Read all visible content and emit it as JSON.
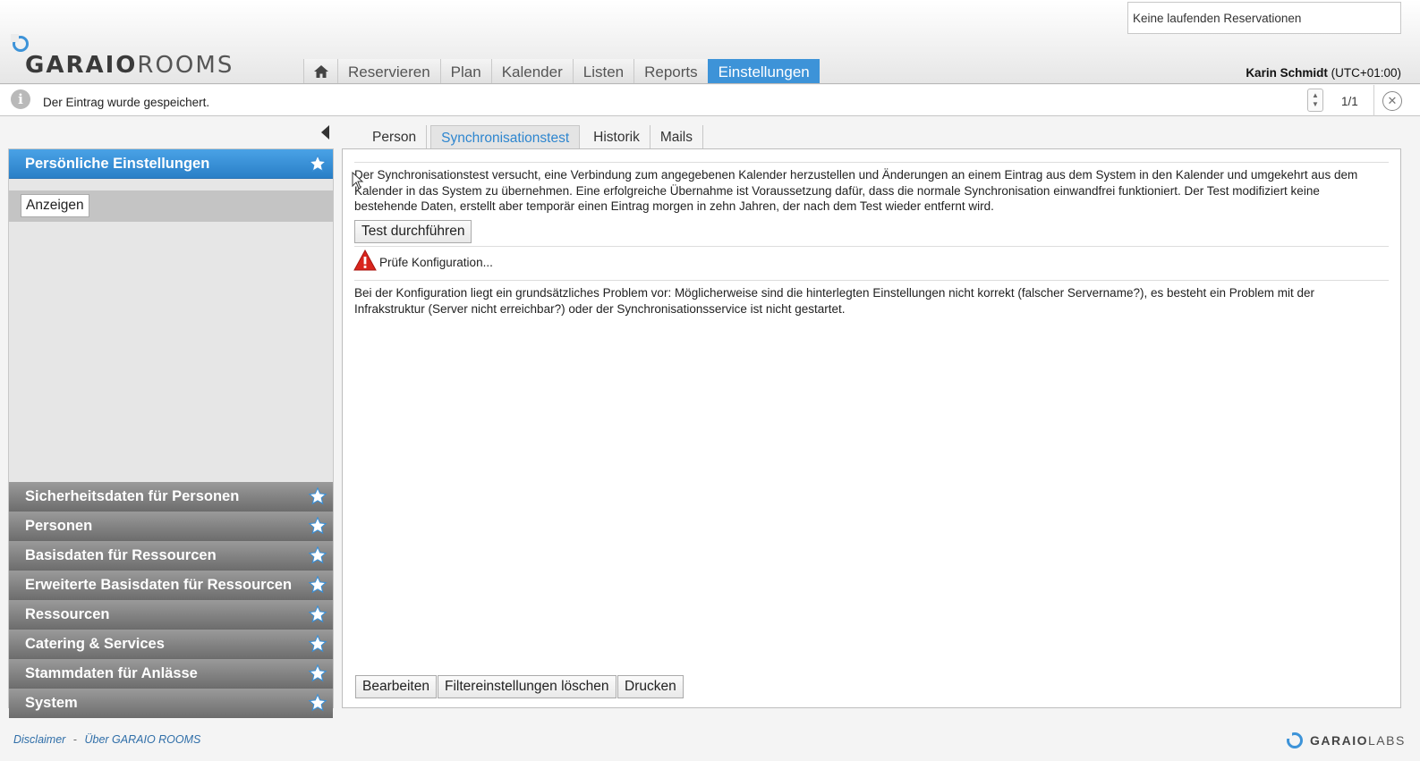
{
  "header": {
    "logo_bold": "GARAIO",
    "logo_light": "ROOMS",
    "reservations_status": "Keine laufenden Reservationen",
    "nav": [
      "Reservieren",
      "Plan",
      "Kalender",
      "Listen",
      "Reports",
      "Einstellungen"
    ],
    "active_nav": "Einstellungen",
    "user_name": "Karin Schmidt",
    "user_tz": "(UTC+01:00)"
  },
  "infobar": {
    "message": "Der Eintrag wurde gespeichert.",
    "pager": "1/1"
  },
  "sidebar": {
    "active_section": "Persönliche Einstellungen",
    "active_sub_button": "Anzeigen",
    "sections": [
      "Sicherheitsdaten für Personen",
      "Personen",
      "Basisdaten für Ressourcen",
      "Erweiterte Basisdaten für Ressourcen",
      "Ressourcen",
      "Catering & Services",
      "Stammdaten für Anlässe",
      "System"
    ]
  },
  "tabs": [
    "Person",
    "Synchronisationstest",
    "Historik",
    "Mails"
  ],
  "active_tab": "Synchronisationstest",
  "main": {
    "intro": "Der Synchronisationstest versucht, eine Verbindung zum angegebenen Kalender herzustellen und Änderungen an einem Eintrag aus dem System in den Kalender und umgekehrt aus dem Kalender in das System zu übernehmen. Eine erfolgreiche Übernahme ist Voraussetzung dafür, dass die normale Synchronisation einwandfrei funktioniert. Der Test modifiziert keine bestehende Daten, erstellt aber temporär einen Eintrag morgen in zehn Jahren, der nach dem Test wieder entfernt wird.",
    "run_test_label": "Test durchführen",
    "check_status": "Prüfe Konfiguration...",
    "error_text": "Bei der Konfiguration liegt ein grundsätzliches Problem vor: Möglicherweise sind die hinterlegten Einstellungen nicht korrekt (falscher Servername?), es besteht ein Problem mit der Infrakstruktur (Server nicht erreichbar?) oder der Synchronisationsservice ist nicht gestartet.",
    "edit_label": "Bearbeiten",
    "clear_filter_label": "Filtereinstellungen löschen",
    "print_label": "Drucken"
  },
  "footer": {
    "disclaimer": "Disclaimer",
    "separator": "-",
    "about": "Über GARAIO ROOMS",
    "labs_bold": "GARAIO",
    "labs_light": "LABS"
  },
  "colors": {
    "accent": "#3d93d8",
    "section_gray": "#7d7d7d",
    "warning_red": "#d9251d"
  },
  "icons": {
    "home": "home-icon",
    "info": "info-icon",
    "star": "star-icon",
    "warning": "warning-icon",
    "close": "close-icon",
    "collapse": "collapse-left-icon"
  }
}
